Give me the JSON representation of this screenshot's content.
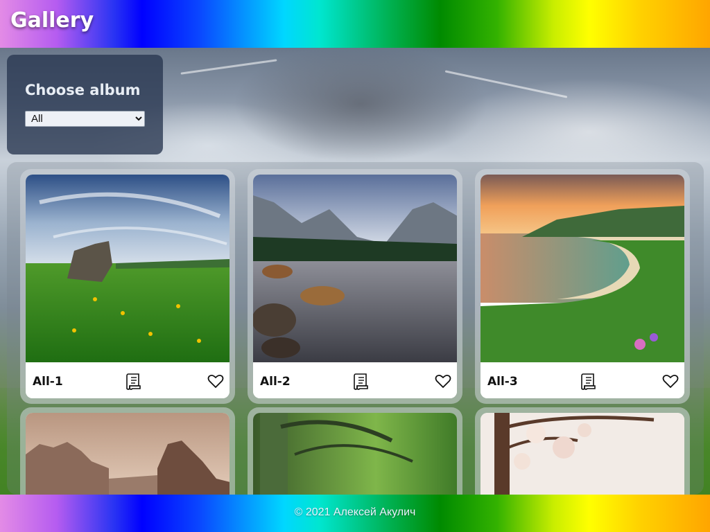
{
  "header": {
    "title": "Gallery"
  },
  "album_chooser": {
    "label": "Choose album",
    "selected": "All",
    "options": [
      "All"
    ]
  },
  "gallery": {
    "cards": [
      {
        "title": "All-1",
        "details_icon": "document-icon",
        "like_icon": "heart-icon"
      },
      {
        "title": "All-2",
        "details_icon": "document-icon",
        "like_icon": "heart-icon"
      },
      {
        "title": "All-3",
        "details_icon": "document-icon",
        "like_icon": "heart-icon"
      }
    ]
  },
  "footer": {
    "copyright": "© 2021 Алексей Акулич"
  },
  "colors": {
    "header_gradient_start": "#e38be6",
    "header_gradient_end": "#ffa500",
    "panel": "#283650"
  }
}
